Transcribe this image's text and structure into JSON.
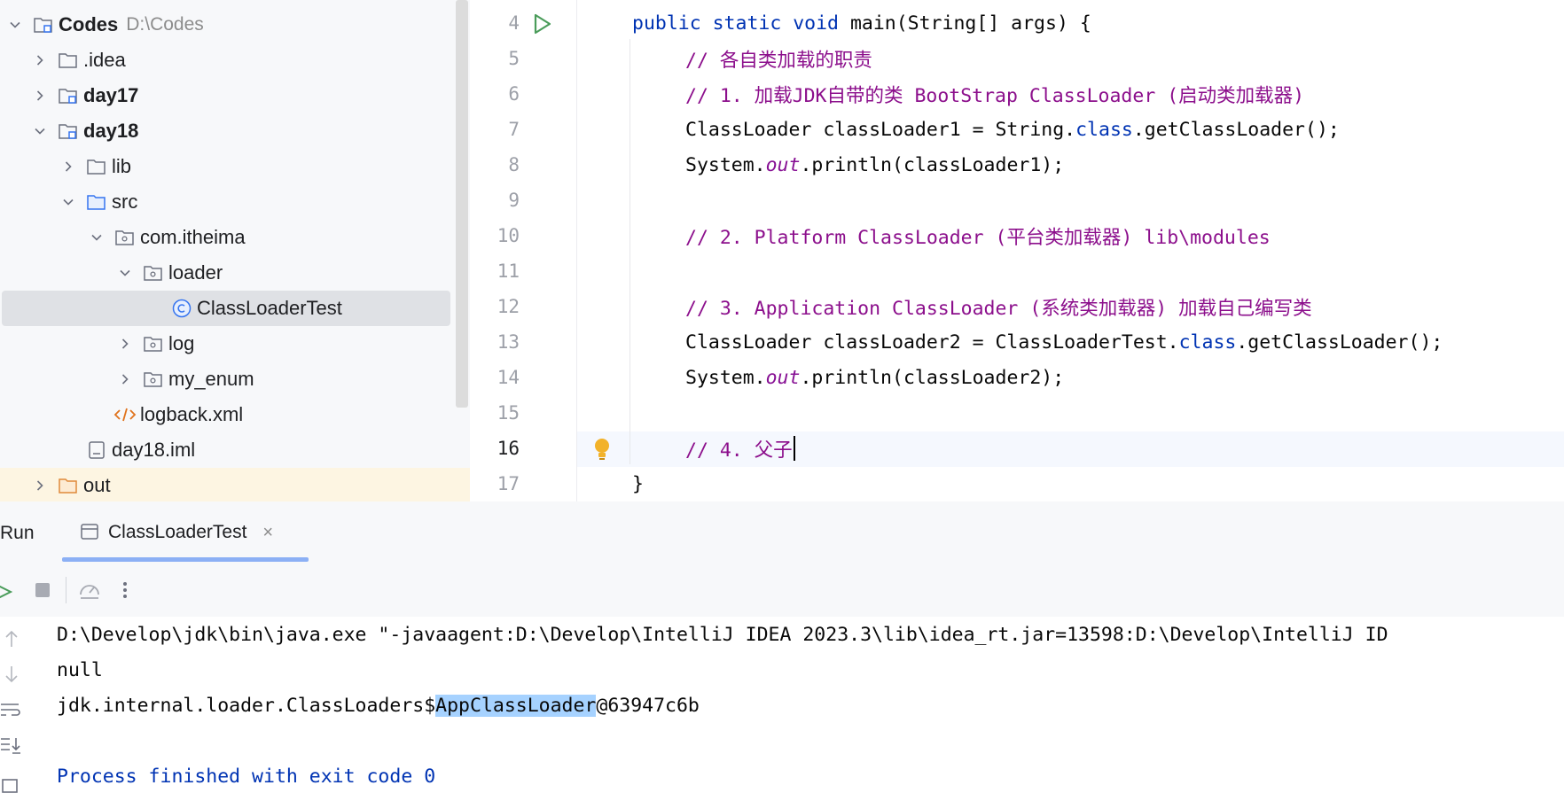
{
  "project_tree": {
    "items": [
      {
        "label": "Codes",
        "path": "D:\\Codes",
        "chevron": "down",
        "icon": "module-folder-icon",
        "bold": true
      },
      {
        "label": ".idea",
        "chevron": "right",
        "icon": "folder-icon"
      },
      {
        "label": "day17",
        "chevron": "right",
        "icon": "module-folder-icon",
        "bold": true
      },
      {
        "label": "day18",
        "chevron": "down",
        "icon": "module-folder-icon",
        "bold": true
      },
      {
        "label": "lib",
        "chevron": "right",
        "icon": "folder-icon"
      },
      {
        "label": "src",
        "chevron": "down",
        "icon": "source-folder-icon"
      },
      {
        "label": "com.itheima",
        "chevron": "down",
        "icon": "package-icon"
      },
      {
        "label": "loader",
        "chevron": "down",
        "icon": "package-icon"
      },
      {
        "label": "ClassLoaderTest",
        "chevron": "none",
        "icon": "java-class-icon",
        "selected": true
      },
      {
        "label": "log",
        "chevron": "right",
        "icon": "package-icon"
      },
      {
        "label": "my_enum",
        "chevron": "right",
        "icon": "package-icon"
      },
      {
        "label": "logback.xml",
        "chevron": "none",
        "icon": "xml-file-icon"
      },
      {
        "label": "day18.iml",
        "chevron": "none",
        "icon": "iml-file-icon"
      },
      {
        "label": "out",
        "chevron": "right",
        "icon": "excluded-folder-icon"
      }
    ]
  },
  "editor": {
    "line_numbers": [
      "4",
      "5",
      "6",
      "7",
      "8",
      "9",
      "10",
      "11",
      "12",
      "13",
      "14",
      "15",
      "16",
      "17"
    ],
    "current_line": "16",
    "lines": {
      "l4": {
        "kw": "public static void",
        "rest": " main(String[] args) {"
      },
      "l5": "// 各自类加载的职责",
      "l6": "// 1. 加载JDK自带的类 BootStrap ClassLoader (启动类加载器)",
      "l7": {
        "a": "ClassLoader classLoader1 = String.",
        "kw": "class",
        "b": ".getClassLoader();"
      },
      "l8": {
        "a": "System.",
        "fld": "out",
        "b": ".println(classLoader1);"
      },
      "l10": "// 2. Platform ClassLoader (平台类加载器) lib\\modules",
      "l12": "// 3. Application ClassLoader (系统类加载器) 加载自己编写类",
      "l13": {
        "a": "ClassLoader classLoader2 = ClassLoaderTest.",
        "kw": "class",
        "b": ".getClassLoader();"
      },
      "l14": {
        "a": "System.",
        "fld": "out",
        "b": ".println(classLoader2);"
      },
      "l16": "// 4. 父子",
      "l17": "}"
    }
  },
  "run_panel": {
    "title": "Run",
    "tab_label": "ClassLoaderTest",
    "tab_close": "×",
    "console": {
      "command": "D:\\Develop\\jdk\\bin\\java.exe \"-javaagent:D:\\Develop\\IntelliJ IDEA 2023.3\\lib\\idea_rt.jar=13598:D:\\Develop\\IntelliJ ID",
      "line1": "null",
      "line2_pre": "jdk.internal.loader.ClassLoaders$",
      "line2_sel": "AppClassLoader",
      "line2_post": "@63947c6b",
      "finish": "Process finished with exit code 0"
    }
  },
  "colors": {
    "keyword": "#0033b3",
    "comment": "#8c0f8c",
    "static_field": "#871094",
    "selection": "#a6d2ff",
    "run_icon": "#4a9c5a",
    "bulb": "#e8a317"
  }
}
